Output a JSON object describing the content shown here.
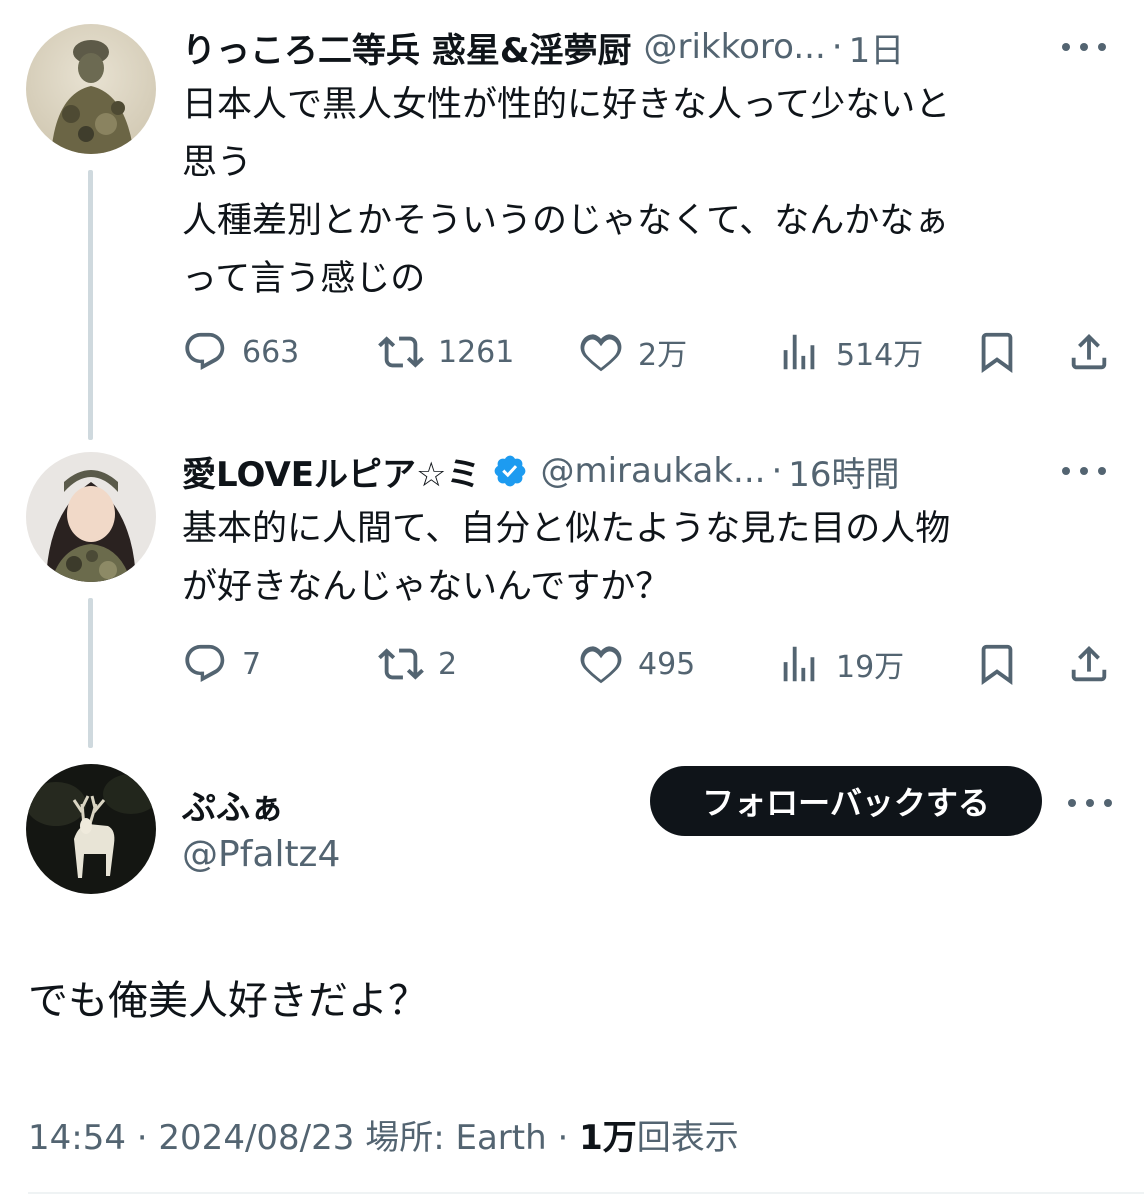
{
  "tweets": [
    {
      "name": "りっころ二等兵 惑星&淫夢厨",
      "handle": "@rikkoro...",
      "dot": "·",
      "time": "1日",
      "text": "日本人で黒人女性が性的に好きな人って少ないと\n思う\n人種差別とかそういうのじゃなくて、なんかなぁ\nって言う感じの",
      "replies": "663",
      "retweets": "1261",
      "likes": "2万",
      "views": "514万"
    },
    {
      "name": "愛LOVEルピア☆ミ",
      "handle": "@miraukak...",
      "dot": "·",
      "time": "16時間",
      "text": "基本的に人間て、自分と似たような見た目の人物\nが好きなんじゃないんですか？",
      "replies": "7",
      "retweets": "2",
      "likes": "495",
      "views": "19万"
    }
  ],
  "main": {
    "name": "ぷふぁ",
    "handle": "@Pfaltz4",
    "follow_label": "フォローバックする",
    "text": "でも俺美人好きだよ？",
    "time": "14:54",
    "sep1": "·",
    "date": "2024/08/23",
    "location": "場所: Earth",
    "sep2": "·",
    "views_count": "1万",
    "views_suffix": "回表示"
  },
  "colors": {
    "text": "#0f1419",
    "secondary": "#536471",
    "verified": "#1d9bf0",
    "thread_line": "#cfd9de"
  },
  "icons": [
    "reply-icon",
    "retweet-icon",
    "like-icon",
    "views-icon",
    "bookmark-icon",
    "share-icon",
    "more-icon",
    "verified-icon"
  ]
}
